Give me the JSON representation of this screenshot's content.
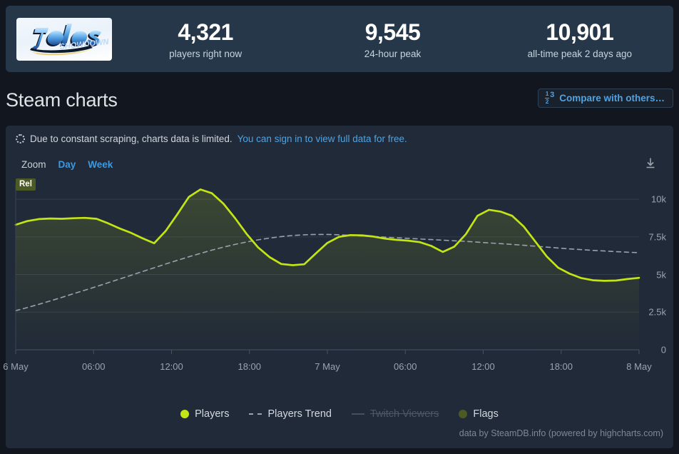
{
  "header": {
    "logo_alt": "Idols Showdown",
    "stats": [
      {
        "value": "4,321",
        "label": "players right now"
      },
      {
        "value": "9,545",
        "label": "24-hour peak"
      },
      {
        "value": "10,901",
        "label": "all-time peak 2 days ago"
      }
    ]
  },
  "section": {
    "title": "Steam charts",
    "compare_label": "Compare with others…",
    "compare_icon": "fraction-icon"
  },
  "notice": {
    "icon": "spinner-icon",
    "text": "Due to constant scraping, charts data is limited.",
    "link_text": "You can sign in to view full data for free."
  },
  "controls": {
    "zoom_label": "Zoom",
    "options": [
      "Day",
      "Week"
    ],
    "download_icon": "download-icon"
  },
  "chart_flag": {
    "label": "Rel"
  },
  "legend": [
    {
      "label": "Players",
      "marker": "dot",
      "color": "#c3e415",
      "enabled": true
    },
    {
      "label": "Players Trend",
      "marker": "dashed-line",
      "color": "#9aa4b0",
      "enabled": true
    },
    {
      "label": "Twitch Viewers",
      "marker": "line",
      "color": "#454f5d",
      "enabled": false
    },
    {
      "label": "Flags",
      "marker": "dot",
      "color": "#4c5a26",
      "enabled": true
    }
  ],
  "credit": "data by SteamDB.info (powered by highcharts.com)",
  "colors": {
    "page_bg": "#12161f",
    "panel_bg": "#253749",
    "card_bg": "#212a38",
    "accent_link": "#4fa3e3",
    "players_line": "#c3e415",
    "trend_line": "#9aa4b0",
    "grid": "#323d4d"
  },
  "chart_data": {
    "type": "line",
    "title": "Steam charts",
    "xlabel": "",
    "ylabel": "",
    "grid": true,
    "legend_position": "bottom",
    "ylim": [
      0,
      11000
    ],
    "yticks": [
      0,
      2500,
      5000,
      7500,
      10000
    ],
    "ytick_labels": [
      "0",
      "2.5k",
      "5k",
      "7.5k",
      "10k"
    ],
    "xtick_labels": [
      "6 May",
      "06:00",
      "12:00",
      "18:00",
      "7 May",
      "06:00",
      "12:00",
      "18:00",
      "8 May"
    ],
    "xtick_positions": [
      0,
      6,
      12,
      18,
      24,
      30,
      36,
      42,
      48
    ],
    "x_hours": [
      0,
      1,
      2,
      3,
      4,
      5,
      6,
      7,
      8,
      9,
      10,
      11,
      12,
      13,
      14,
      15,
      16,
      17,
      18,
      19,
      20,
      21,
      22,
      23,
      24,
      25,
      26,
      27,
      28,
      29,
      30,
      31,
      32,
      33,
      34,
      35,
      36,
      37,
      38,
      39,
      40,
      41,
      42,
      43,
      44,
      45,
      46,
      47,
      48
    ],
    "series": [
      {
        "name": "Players",
        "color": "#c3e415",
        "style": "solid",
        "values": [
          8300,
          8550,
          8680,
          8720,
          8700,
          8740,
          8760,
          8700,
          8400,
          8060,
          7760,
          7400,
          7080,
          7900,
          9000,
          10150,
          10650,
          10400,
          9700,
          8750,
          7700,
          6800,
          6150,
          5700,
          5620,
          5680,
          6400,
          7100,
          7500,
          7620,
          7600,
          7520,
          7380,
          7300,
          7250,
          7150,
          6900,
          6500,
          6850,
          7680,
          8900,
          9300,
          9180,
          8900,
          8200,
          7200,
          6200,
          5450,
          5050,
          4760,
          4620,
          4580,
          4600,
          4700,
          4780
        ]
      },
      {
        "name": "Players Trend",
        "color": "#9aa4b0",
        "style": "dashed",
        "values": [
          2600,
          2800,
          3020,
          3250,
          3480,
          3720,
          3960,
          4200,
          4450,
          4700,
          4950,
          5200,
          5450,
          5700,
          5940,
          6180,
          6400,
          6620,
          6820,
          7000,
          7160,
          7300,
          7420,
          7520,
          7590,
          7640,
          7660,
          7660,
          7640,
          7600,
          7560,
          7520,
          7480,
          7440,
          7400,
          7360,
          7320,
          7280,
          7240,
          7200,
          7150,
          7100,
          7050,
          7000,
          6940,
          6880,
          6820,
          6760,
          6700,
          6650,
          6600,
          6560,
          6520,
          6480,
          6450
        ]
      },
      {
        "name": "Twitch Viewers",
        "color": "#454f5d",
        "style": "solid",
        "enabled": false,
        "values": []
      }
    ],
    "flags": [
      {
        "label": "Rel",
        "x": 0
      }
    ]
  }
}
